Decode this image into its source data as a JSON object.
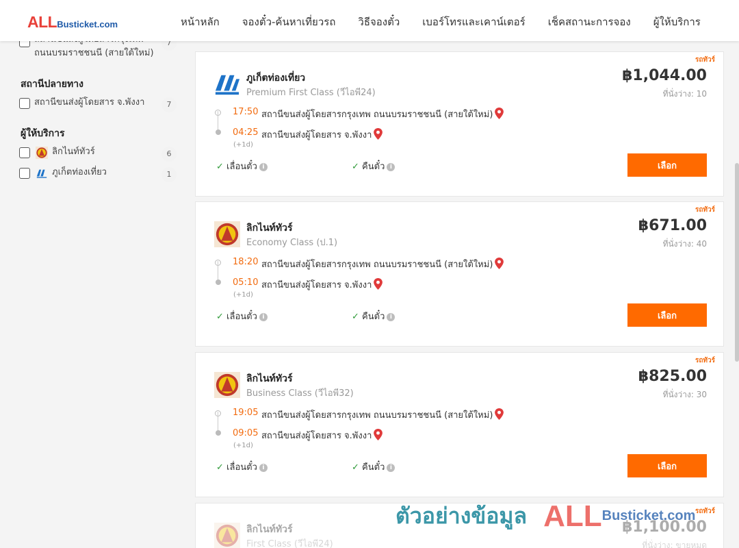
{
  "header": {
    "logo_all": "ALL",
    "logo_rest": "Busticket.com",
    "nav": [
      {
        "label": "หน้าหลัก"
      },
      {
        "label": "จองตั๋ว-ค้นหาเที่ยวรถ"
      },
      {
        "label": "วิธีจองตั๋ว"
      },
      {
        "label": "เบอร์โทรและเคาน์เตอร์"
      },
      {
        "label": "เช็คสถานะการจอง"
      },
      {
        "label": "ผู้ให้บริการ"
      }
    ]
  },
  "sidebar": {
    "origin_items": [
      {
        "label": "สถานีขนส่งผู้โดยสารกรุงเทพ ถนนบรมราชชนนี (สายใต้ใหม่)",
        "count": "7"
      }
    ],
    "destination_heading": "สถานีปลายทาง",
    "destination_items": [
      {
        "label": "สถานีขนส่งผู้โดยสาร จ.พังงา",
        "count": "7"
      }
    ],
    "operator_heading": "ผู้ให้บริการ",
    "operator_items": [
      {
        "label": "ลิกไนท์ทัวร์",
        "count": "6"
      },
      {
        "label": "ภูเก็ตท่องเที่ยว",
        "count": "1"
      }
    ]
  },
  "features": {
    "change": "เลื่อนตั๋ว",
    "refund": "คืนตั๋ว",
    "select_label": "เลือก",
    "badge": "รถทัวร์",
    "plus_day": "(+1d)"
  },
  "trips": [
    {
      "operator": "ภูเก็ตท่องเที่ยว",
      "class": "Premium First Class (วีไอพี24)",
      "price": "฿1,044.00",
      "seats": "ที่นั่งว่าง: 10",
      "dep_time": "17:50",
      "dep_station": "สถานีขนส่งผู้โดยสารกรุงเทพ ถนนบรมราชชนนี (สายใต้ใหม่)",
      "arr_time": "04:25",
      "arr_station": "สถานีขนส่งผู้โดยสาร จ.พังงา"
    },
    {
      "operator": "ลิกไนท์ทัวร์",
      "class": "Economy Class (ป.1)",
      "price": "฿671.00",
      "seats": "ที่นั่งว่าง: 40",
      "dep_time": "18:20",
      "dep_station": "สถานีขนส่งผู้โดยสารกรุงเทพ ถนนบรมราชชนนี (สายใต้ใหม่)",
      "arr_time": "05:10",
      "arr_station": "สถานีขนส่งผู้โดยสาร จ.พังงา"
    },
    {
      "operator": "ลิกไนท์ทัวร์",
      "class": "Business Class (วีไอพี32)",
      "price": "฿825.00",
      "seats": "ที่นั่งว่าง: 30",
      "dep_time": "19:05",
      "dep_station": "สถานีขนส่งผู้โดยสารกรุงเทพ ถนนบรมราชชนนี (สายใต้ใหม่)",
      "arr_time": "09:05",
      "arr_station": "สถานีขนส่งผู้โดยสาร จ.พังงา"
    },
    {
      "operator": "ลิกไนท์ทัวร์",
      "class": "First Class (วีไอพี24)",
      "price": "฿1,100.00",
      "seats": "ที่นั่งว่าง: ขายหมด"
    }
  ],
  "watermark": {
    "text": "ตัวอย่างข้อมูล",
    "logo_all": "ALL",
    "logo_rest": "Busticket.com"
  },
  "colors": {
    "accent": "#ff6a00",
    "time": "#f26b0f",
    "check": "#2e9a38",
    "pin": "#e03a3a",
    "logo_red": "#e8413a",
    "logo_blue": "#1e5aa8"
  }
}
